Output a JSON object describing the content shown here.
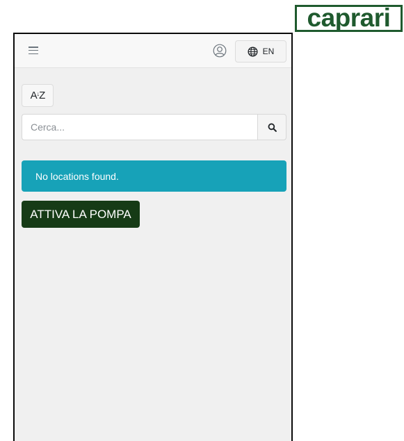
{
  "brand": {
    "logo_text": "caprari",
    "color": "#1f5a2e"
  },
  "navbar": {
    "menu_icon": "hamburger-menu-icon",
    "user_icon": "user-circle-icon",
    "language": {
      "icon": "globe-icon",
      "label": "EN"
    }
  },
  "toolbar": {
    "sort_icon": "sort-alpha-icon",
    "sort_label_a": "A",
    "sort_label_arrow": "↓",
    "sort_label_z": "Z"
  },
  "search": {
    "value": "",
    "placeholder": "Cerca...",
    "button_icon": "search-icon"
  },
  "results": {
    "empty_message": "No locations found.",
    "alert_color": "#17a2b8"
  },
  "actions": {
    "activate_label": "ATTIVA LA POMPA",
    "activate_color": "#163b16"
  }
}
